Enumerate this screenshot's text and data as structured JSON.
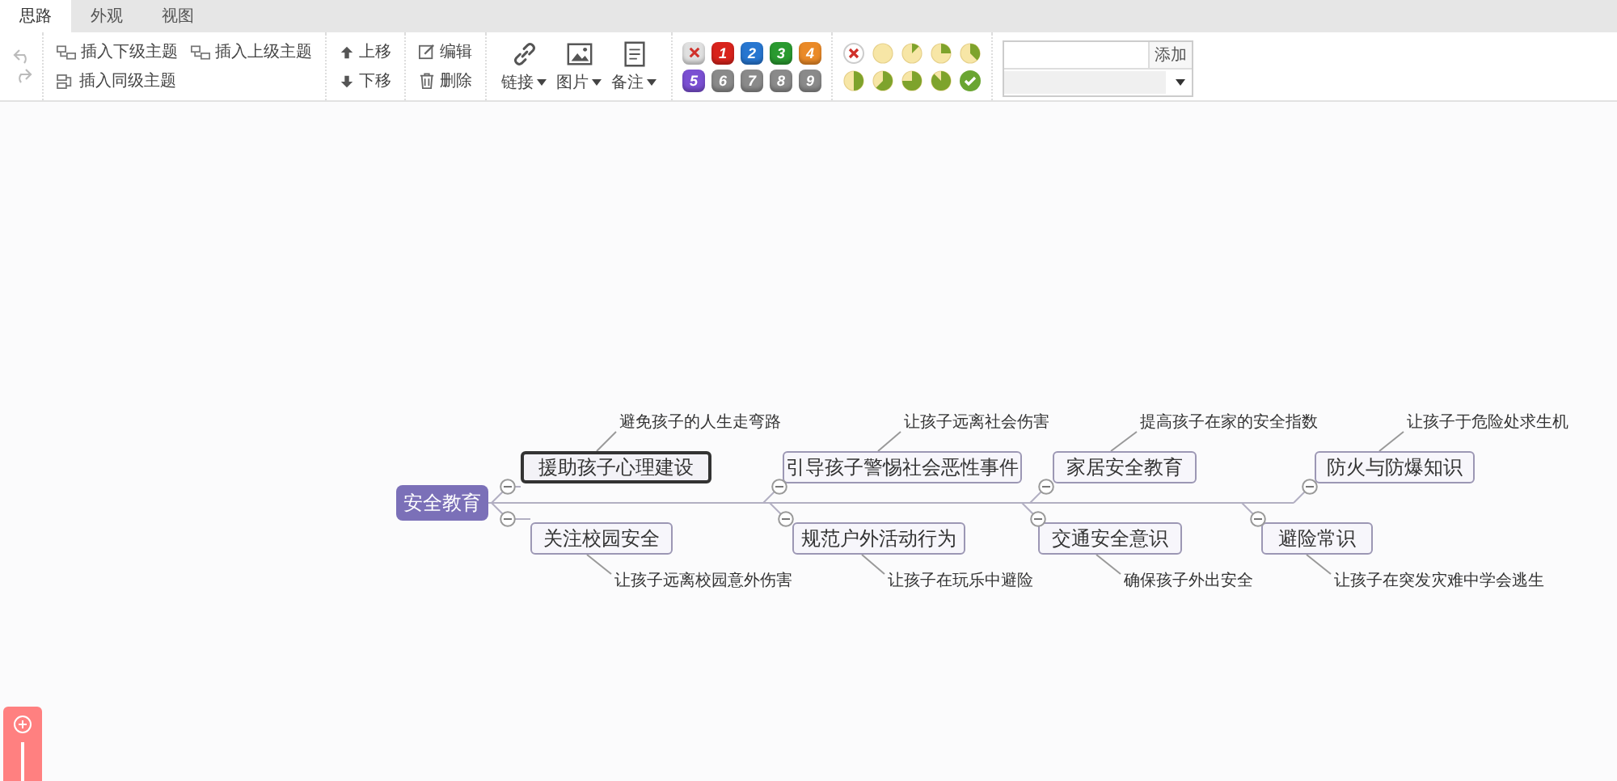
{
  "tabs": [
    {
      "label": "思路",
      "selected": true
    },
    {
      "label": "外观",
      "selected": false
    },
    {
      "label": "视图",
      "selected": false
    }
  ],
  "toolbar": {
    "insert": [
      {
        "label": "插入下级主题",
        "kind": "child"
      },
      {
        "label": "插入上级主题",
        "kind": "parent"
      },
      {
        "label": "插入同级主题",
        "kind": "sibling"
      }
    ],
    "move": [
      {
        "label": "上移",
        "kind": "up"
      },
      {
        "label": "下移",
        "kind": "down"
      }
    ],
    "edit": [
      {
        "label": "编辑",
        "kind": "edit"
      },
      {
        "label": "删除",
        "kind": "delete"
      }
    ],
    "media": [
      {
        "label": "链接",
        "kind": "link"
      },
      {
        "label": "图片",
        "kind": "image"
      },
      {
        "label": "备注",
        "kind": "note"
      }
    ],
    "priorities": [
      {
        "kind": "clear",
        "color": "#e0e0e0"
      },
      {
        "kind": "number",
        "label": "1",
        "color": "#d8231c"
      },
      {
        "kind": "number",
        "label": "2",
        "color": "#2776d0"
      },
      {
        "kind": "number",
        "label": "3",
        "color": "#2a9a30"
      },
      {
        "kind": "number",
        "label": "4",
        "color": "#ea8a28"
      },
      {
        "kind": "number",
        "label": "5",
        "color": "#7a4fd2"
      },
      {
        "kind": "number",
        "label": "6",
        "color": "#8a8a8a"
      },
      {
        "kind": "number",
        "label": "7",
        "color": "#8a8a8a"
      },
      {
        "kind": "number",
        "label": "8",
        "color": "#8a8a8a"
      },
      {
        "kind": "number",
        "label": "9",
        "color": "#8a8a8a"
      }
    ],
    "search": {
      "button": "添加"
    }
  },
  "mindmap": {
    "root": "安全教育",
    "branches": [
      {
        "kind": "top",
        "label": "援助孩子心理建设",
        "selected": true,
        "expanded": true,
        "note": "避免孩子的人生走弯路"
      },
      {
        "kind": "top",
        "label": "引导孩子警惕社会恶性事件",
        "selected": false,
        "expanded": true,
        "note": "让孩子远离社会伤害"
      },
      {
        "kind": "top",
        "label": "家居安全教育",
        "selected": false,
        "expanded": true,
        "note": "提高孩子在家的安全指数"
      },
      {
        "kind": "top",
        "label": "防火与防爆知识",
        "selected": false,
        "expanded": true,
        "note": "让孩子于危险处求生机"
      },
      {
        "kind": "bottom",
        "label": "关注校园安全",
        "selected": false,
        "expanded": true,
        "note": "让孩子远离校园意外伤害"
      },
      {
        "kind": "bottom",
        "label": "规范户外活动行为",
        "selected": false,
        "expanded": true,
        "note": "让孩子在玩乐中避险"
      },
      {
        "kind": "bottom",
        "label": "交通安全意识",
        "selected": false,
        "expanded": true,
        "note": "确保孩子外出安全"
      },
      {
        "kind": "bottom",
        "label": "避险常识",
        "selected": false,
        "expanded": true,
        "note": "让孩子在突发灾难中学会逃生"
      }
    ]
  }
}
